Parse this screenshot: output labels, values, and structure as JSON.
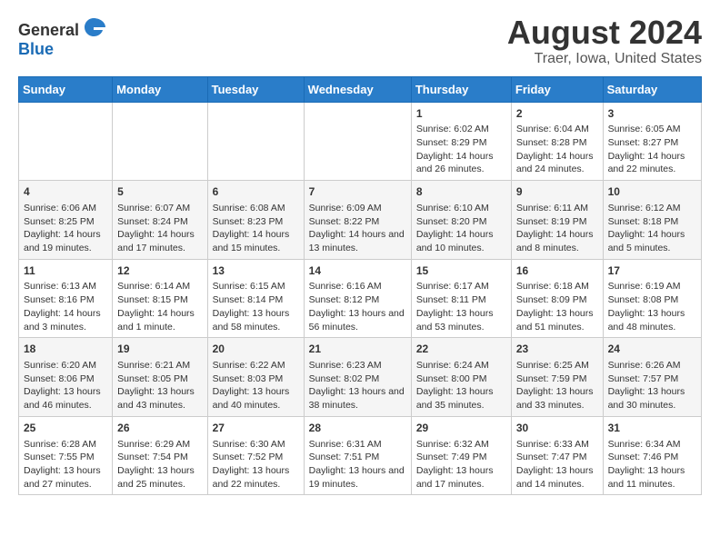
{
  "logo": {
    "general": "General",
    "blue": "Blue"
  },
  "title": "August 2024",
  "subtitle": "Traer, Iowa, United States",
  "weekdays": [
    "Sunday",
    "Monday",
    "Tuesday",
    "Wednesday",
    "Thursday",
    "Friday",
    "Saturday"
  ],
  "weeks": [
    [
      {
        "day": "",
        "info": ""
      },
      {
        "day": "",
        "info": ""
      },
      {
        "day": "",
        "info": ""
      },
      {
        "day": "",
        "info": ""
      },
      {
        "day": "1",
        "info": "Sunrise: 6:02 AM\nSunset: 8:29 PM\nDaylight: 14 hours and 26 minutes."
      },
      {
        "day": "2",
        "info": "Sunrise: 6:04 AM\nSunset: 8:28 PM\nDaylight: 14 hours and 24 minutes."
      },
      {
        "day": "3",
        "info": "Sunrise: 6:05 AM\nSunset: 8:27 PM\nDaylight: 14 hours and 22 minutes."
      }
    ],
    [
      {
        "day": "4",
        "info": "Sunrise: 6:06 AM\nSunset: 8:25 PM\nDaylight: 14 hours and 19 minutes."
      },
      {
        "day": "5",
        "info": "Sunrise: 6:07 AM\nSunset: 8:24 PM\nDaylight: 14 hours and 17 minutes."
      },
      {
        "day": "6",
        "info": "Sunrise: 6:08 AM\nSunset: 8:23 PM\nDaylight: 14 hours and 15 minutes."
      },
      {
        "day": "7",
        "info": "Sunrise: 6:09 AM\nSunset: 8:22 PM\nDaylight: 14 hours and 13 minutes."
      },
      {
        "day": "8",
        "info": "Sunrise: 6:10 AM\nSunset: 8:20 PM\nDaylight: 14 hours and 10 minutes."
      },
      {
        "day": "9",
        "info": "Sunrise: 6:11 AM\nSunset: 8:19 PM\nDaylight: 14 hours and 8 minutes."
      },
      {
        "day": "10",
        "info": "Sunrise: 6:12 AM\nSunset: 8:18 PM\nDaylight: 14 hours and 5 minutes."
      }
    ],
    [
      {
        "day": "11",
        "info": "Sunrise: 6:13 AM\nSunset: 8:16 PM\nDaylight: 14 hours and 3 minutes."
      },
      {
        "day": "12",
        "info": "Sunrise: 6:14 AM\nSunset: 8:15 PM\nDaylight: 14 hours and 1 minute."
      },
      {
        "day": "13",
        "info": "Sunrise: 6:15 AM\nSunset: 8:14 PM\nDaylight: 13 hours and 58 minutes."
      },
      {
        "day": "14",
        "info": "Sunrise: 6:16 AM\nSunset: 8:12 PM\nDaylight: 13 hours and 56 minutes."
      },
      {
        "day": "15",
        "info": "Sunrise: 6:17 AM\nSunset: 8:11 PM\nDaylight: 13 hours and 53 minutes."
      },
      {
        "day": "16",
        "info": "Sunrise: 6:18 AM\nSunset: 8:09 PM\nDaylight: 13 hours and 51 minutes."
      },
      {
        "day": "17",
        "info": "Sunrise: 6:19 AM\nSunset: 8:08 PM\nDaylight: 13 hours and 48 minutes."
      }
    ],
    [
      {
        "day": "18",
        "info": "Sunrise: 6:20 AM\nSunset: 8:06 PM\nDaylight: 13 hours and 46 minutes."
      },
      {
        "day": "19",
        "info": "Sunrise: 6:21 AM\nSunset: 8:05 PM\nDaylight: 13 hours and 43 minutes."
      },
      {
        "day": "20",
        "info": "Sunrise: 6:22 AM\nSunset: 8:03 PM\nDaylight: 13 hours and 40 minutes."
      },
      {
        "day": "21",
        "info": "Sunrise: 6:23 AM\nSunset: 8:02 PM\nDaylight: 13 hours and 38 minutes."
      },
      {
        "day": "22",
        "info": "Sunrise: 6:24 AM\nSunset: 8:00 PM\nDaylight: 13 hours and 35 minutes."
      },
      {
        "day": "23",
        "info": "Sunrise: 6:25 AM\nSunset: 7:59 PM\nDaylight: 13 hours and 33 minutes."
      },
      {
        "day": "24",
        "info": "Sunrise: 6:26 AM\nSunset: 7:57 PM\nDaylight: 13 hours and 30 minutes."
      }
    ],
    [
      {
        "day": "25",
        "info": "Sunrise: 6:28 AM\nSunset: 7:55 PM\nDaylight: 13 hours and 27 minutes."
      },
      {
        "day": "26",
        "info": "Sunrise: 6:29 AM\nSunset: 7:54 PM\nDaylight: 13 hours and 25 minutes."
      },
      {
        "day": "27",
        "info": "Sunrise: 6:30 AM\nSunset: 7:52 PM\nDaylight: 13 hours and 22 minutes."
      },
      {
        "day": "28",
        "info": "Sunrise: 6:31 AM\nSunset: 7:51 PM\nDaylight: 13 hours and 19 minutes."
      },
      {
        "day": "29",
        "info": "Sunrise: 6:32 AM\nSunset: 7:49 PM\nDaylight: 13 hours and 17 minutes."
      },
      {
        "day": "30",
        "info": "Sunrise: 6:33 AM\nSunset: 7:47 PM\nDaylight: 13 hours and 14 minutes."
      },
      {
        "day": "31",
        "info": "Sunrise: 6:34 AM\nSunset: 7:46 PM\nDaylight: 13 hours and 11 minutes."
      }
    ]
  ]
}
